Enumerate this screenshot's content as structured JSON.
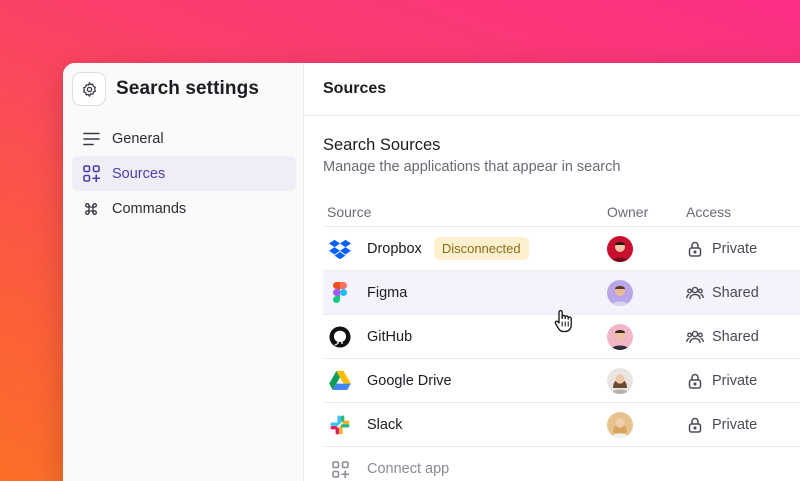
{
  "sidebar": {
    "title": "Search settings",
    "settings_icon": "gear-icon",
    "items": [
      {
        "label": "General",
        "icon": "menu-lines-icon",
        "active": false
      },
      {
        "label": "Sources",
        "icon": "apps-plus-icon",
        "active": true
      },
      {
        "label": "Commands",
        "icon": "command-icon",
        "active": false
      }
    ]
  },
  "main": {
    "header_title": "Sources",
    "section_title": "Search Sources",
    "section_subtitle": "Manage the applications that appear in search",
    "columns": {
      "source": "Source",
      "owner": "Owner",
      "access": "Access"
    },
    "rows": [
      {
        "app": "Dropbox",
        "icon": "dropbox-icon",
        "badge": "Disconnected",
        "access": "Private",
        "access_icon": "lock-icon"
      },
      {
        "app": "Figma",
        "icon": "figma-icon",
        "badge": "",
        "access": "Shared",
        "access_icon": "users-icon"
      },
      {
        "app": "GitHub",
        "icon": "github-icon",
        "badge": "",
        "access": "Shared",
        "access_icon": "users-icon"
      },
      {
        "app": "Google Drive",
        "icon": "google-drive-icon",
        "badge": "",
        "access": "Private",
        "access_icon": "lock-icon"
      },
      {
        "app": "Slack",
        "icon": "slack-icon",
        "badge": "",
        "access": "Private",
        "access_icon": "lock-icon"
      }
    ],
    "connect_label": "Connect app"
  },
  "colors": {
    "accent": "#4a3fb0",
    "active_bg": "#efeef6",
    "badge_bg": "#fdf0cf",
    "badge_text": "#8a6b15"
  }
}
